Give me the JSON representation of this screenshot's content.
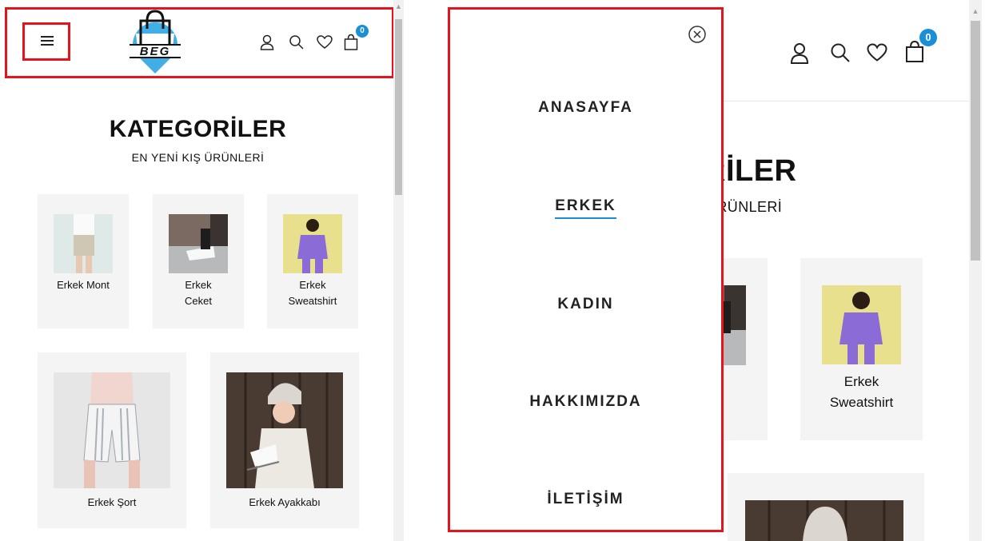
{
  "brand": {
    "logo_text": "BEG"
  },
  "header": {
    "cart_count": "0",
    "icons": [
      "user-icon",
      "search-icon",
      "heart-icon",
      "bag-icon",
      "hamburger-menu-icon"
    ]
  },
  "categories": {
    "title": "KATEGORİLER",
    "subtitle": "EN YENİ KIŞ ÜRÜNLERİ",
    "title_partial": "RİLER",
    "subtitle_partial": "ÜRÜNLERİ",
    "items": [
      {
        "label_line1": "Erkek Mont",
        "label_line2": ""
      },
      {
        "label_line1": "Erkek",
        "label_line2": "Ceket"
      },
      {
        "label_line1": "Erkek",
        "label_line2": "Sweatshirt"
      },
      {
        "label_line1": "Erkek Şort",
        "label_line2": ""
      },
      {
        "label_line1": "Erkek Ayakkabı",
        "label_line2": ""
      }
    ]
  },
  "drawer": {
    "menu": [
      {
        "label": "ANASAYFA",
        "active": false
      },
      {
        "label": "ERKEK",
        "active": true
      },
      {
        "label": "KADIN",
        "active": false
      },
      {
        "label": "HAKKIMIZDA",
        "active": false
      },
      {
        "label": "İLETİŞİM",
        "active": false
      }
    ]
  },
  "colors": {
    "highlight": "#e3141b",
    "accent": "#1a8fd6",
    "card_bg": "#f4f4f4",
    "sweatshirt_bg": "#e9e08e",
    "sweatshirt_color": "#8b6bd6"
  }
}
